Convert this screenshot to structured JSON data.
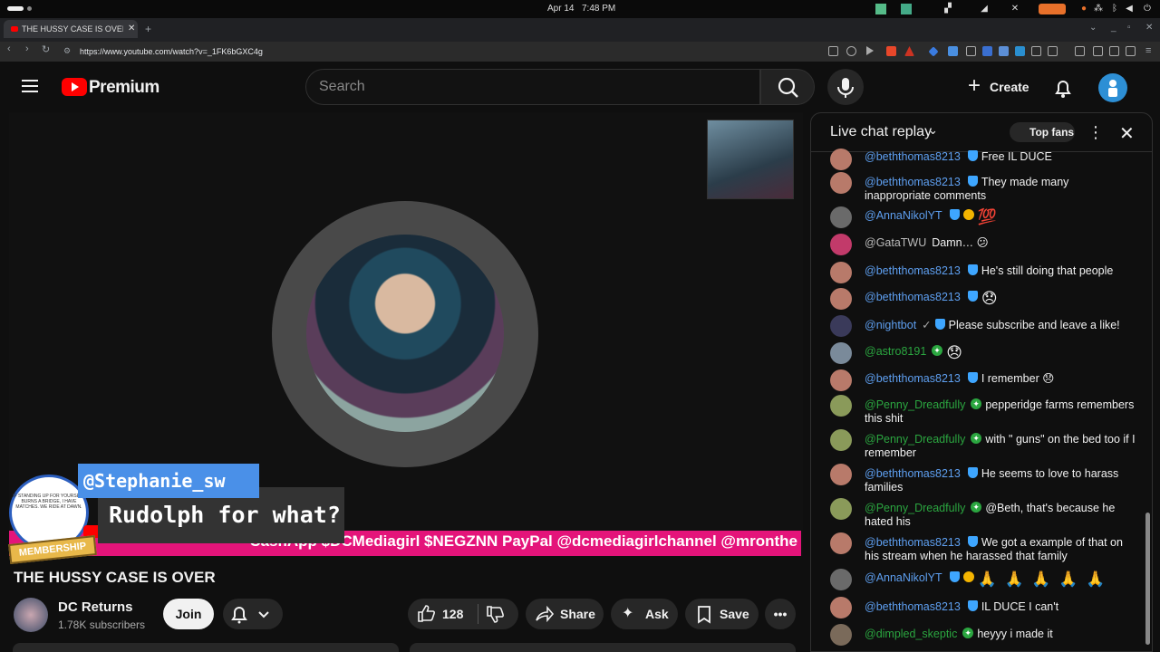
{
  "os": {
    "date": "Apr 14",
    "time": "7:48 PM"
  },
  "browser": {
    "tab_title": "THE HUSSY CASE IS OVER",
    "url": "https://www.youtube.com/watch?v=_1FK6bGXC4g"
  },
  "youtube": {
    "logo_text": "Premium",
    "search_placeholder": "Search",
    "create_label": "Create",
    "accent": "#ff0000"
  },
  "video": {
    "overlay_username": "@Stephanie_sw",
    "overlay_message": "Rudolph for what?",
    "ticker": "CashApp $DCMediagirl $NEGZNN PayPal @dcmediagirlchannel @mronthe",
    "membership_label": "MEMBERSHIP",
    "badge_text": "IF STANDING UP FOR YOURSELF BURNS A BRIDGE, I HAVE MATCHES. WE RIDE AT DAWN.",
    "title": "THE HUSSY CASE IS OVER",
    "channel_name": "DC Returns",
    "subscribers": "1.78K subscribers",
    "join_label": "Join",
    "likes": "128",
    "share_label": "Share",
    "ask_label": "Ask",
    "save_label": "Save"
  },
  "chat": {
    "title": "Live chat replay",
    "top_fans_label": "Top fans",
    "messages": [
      {
        "author": "@beththomas8213",
        "text": "Free IL DUCE"
      },
      {
        "author": "@beththomas8213",
        "text": "They made many inappropriate comments"
      },
      {
        "author": "@AnnaNikolYT",
        "text": "💯"
      },
      {
        "author": "@GataTWU",
        "text": "Damn… 😕"
      },
      {
        "author": "@beththomas8213",
        "text": "He's still doing that people"
      },
      {
        "author": "@beththomas8213",
        "text": "😞"
      },
      {
        "author": "@nightbot",
        "text": "Please subscribe and leave a like!"
      },
      {
        "author": "@astro8191",
        "text": "😞"
      },
      {
        "author": "@beththomas8213",
        "text": "I remember 😞"
      },
      {
        "author": "@Penny_Dreadfully",
        "text": "pepperidge farms remembers this shit"
      },
      {
        "author": "@Penny_Dreadfully",
        "text": "with \" guns\" on the bed too if I remember"
      },
      {
        "author": "@beththomas8213",
        "text": "He seems to love to harass families"
      },
      {
        "author": "@Penny_Dreadfully",
        "text": "@Beth, that's because he hated his"
      },
      {
        "author": "@beththomas8213",
        "text": "We got a example of that on his stream when he harassed that family"
      },
      {
        "author": "@AnnaNikolYT",
        "text": "🙏 🙏 🙏 🙏 🙏"
      },
      {
        "author": "@beththomas8213",
        "text": "IL DUCE I can't"
      },
      {
        "author": "@dimpled_skeptic",
        "text": "heyyy i made it"
      }
    ]
  }
}
